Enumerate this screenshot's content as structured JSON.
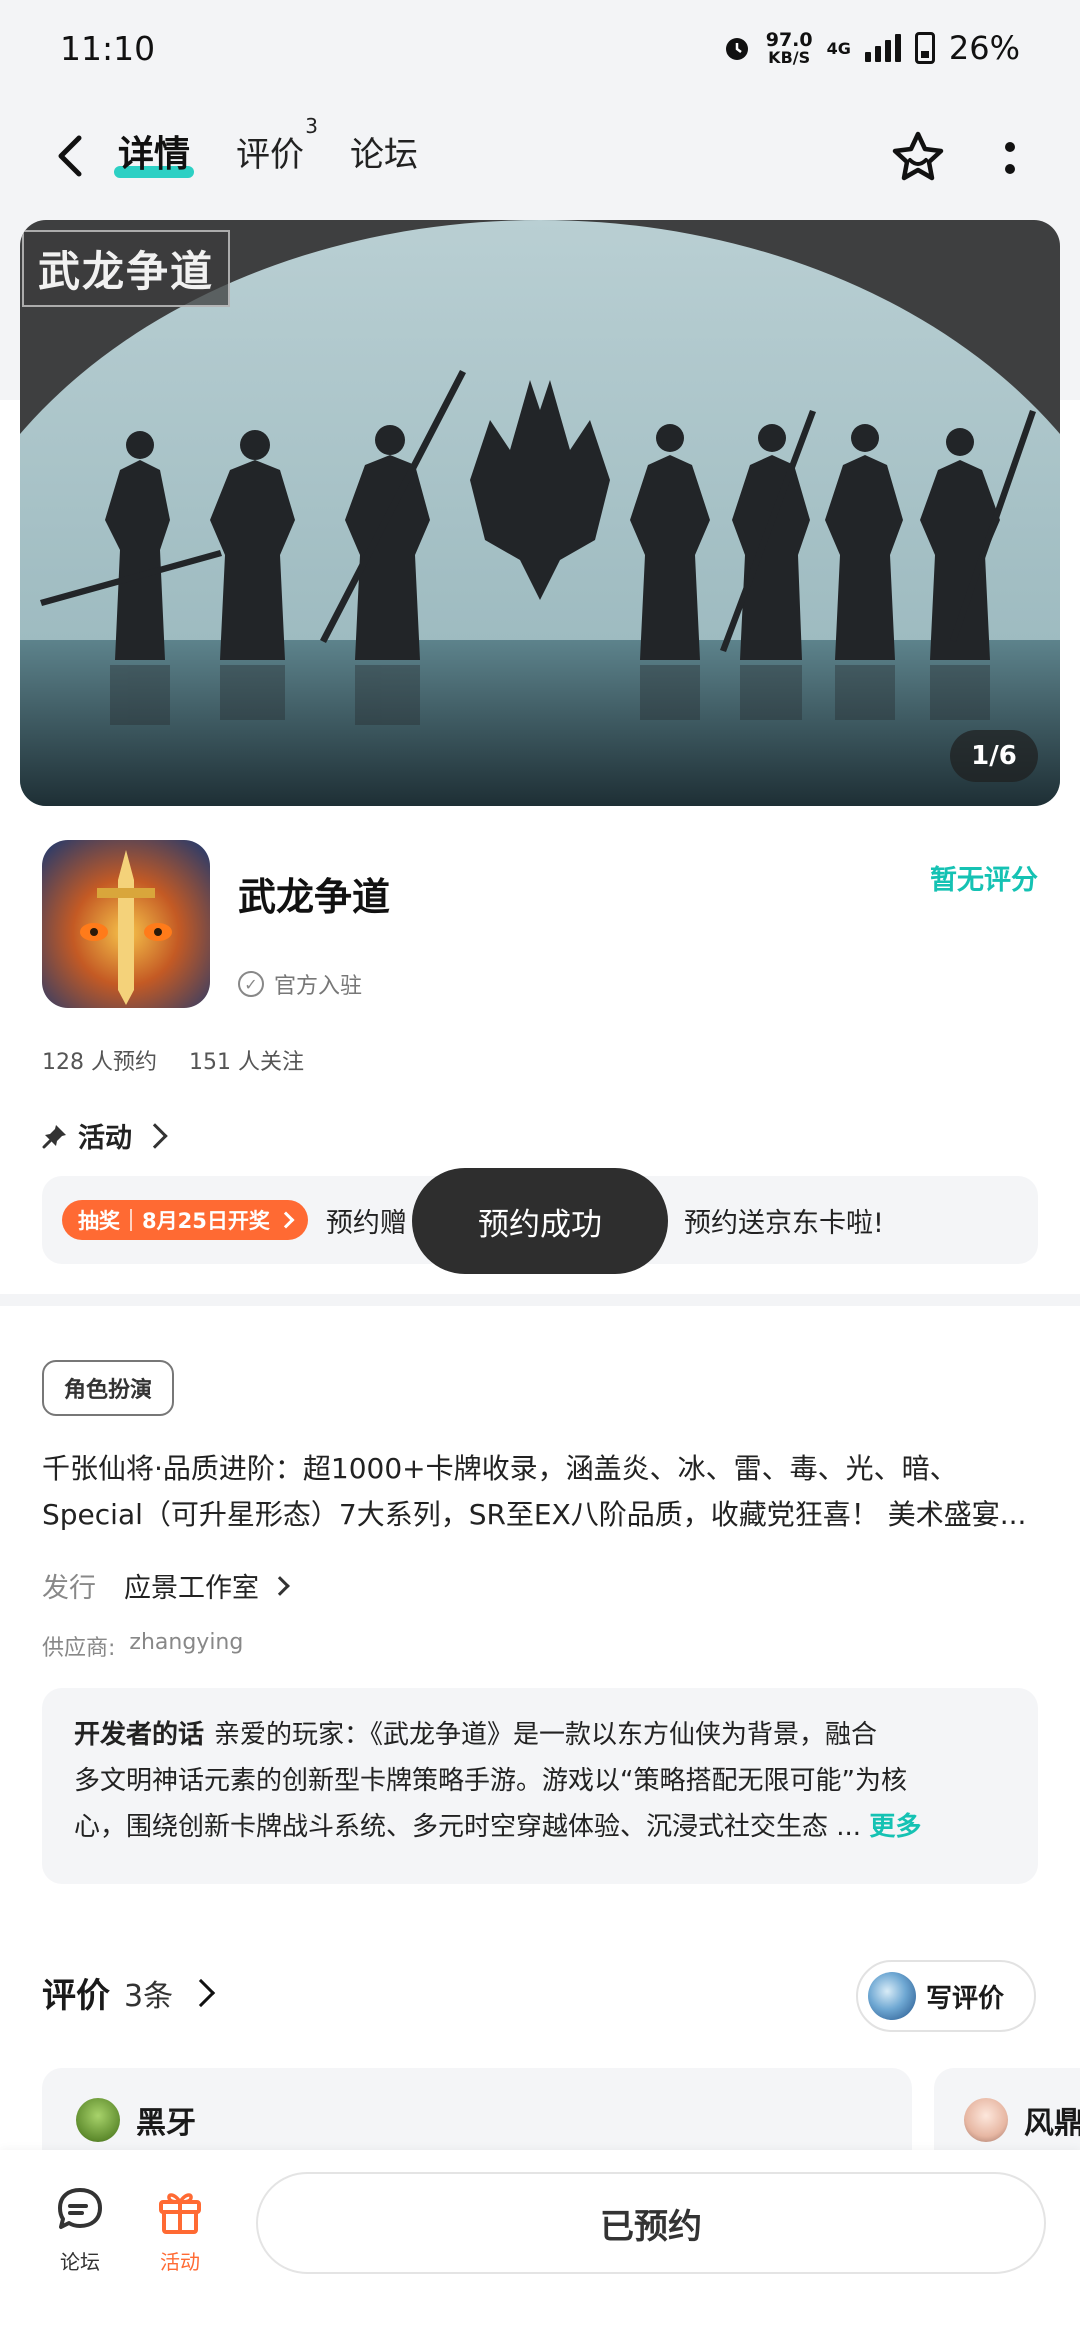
{
  "status_bar": {
    "time": "11:10",
    "net_speed_value": "97.0",
    "net_speed_unit": "KB/S",
    "network": "4G",
    "battery": "26%"
  },
  "nav": {
    "tabs": [
      {
        "label": "详情",
        "active": true
      },
      {
        "label": "评价",
        "badge": "3"
      },
      {
        "label": "论坛"
      }
    ]
  },
  "banner": {
    "logo_text": "武龙争道",
    "counter": "1/6"
  },
  "game": {
    "title": "武龙争道",
    "official_label": "官方入驻",
    "score_text": "暂无评分",
    "score_color": "#15c2b3",
    "reservations": "128 人预约",
    "followers": "151 人关注"
  },
  "activity": {
    "header": "活动",
    "pill_left": "抽奖",
    "pill_right": "8月25日开奖",
    "text_before_toast": "预约赠",
    "text_after_toast": "预约送京东卡啦!",
    "accent_color": "#ff6a33"
  },
  "toast": {
    "text": "预约成功"
  },
  "details": {
    "genre_tag": "角色扮演",
    "description_line1": "千张仙将·品质进阶：超1000+卡牌收录，涵盖炎、冰、雷、毒、光、暗、",
    "description_line2": "Special（可升星形态）7大系列，SR至EX八阶品质，收藏党狂喜！ 美术盛宴...",
    "publisher_label": "发行",
    "publisher_name": "应景工作室",
    "supplier_label": "供应商:",
    "supplier_name": "zhangying"
  },
  "developer_note": {
    "title": "开发者的话",
    "line1": "亲爱的玩家：《武龙争道》是一款以东方仙侠为背景，融合",
    "line2": "多文明神话元素的创新型卡牌策略手游。游戏以“策略搭配无限可能”为核",
    "line3": "心，围绕创新卡牌战斗系统、多元时空穿越体验、沉浸式社交生态 ...",
    "more": "更多"
  },
  "reviews": {
    "title": "评价",
    "count": "3条",
    "write_label": "写评价",
    "items": [
      {
        "name": "黑牙"
      },
      {
        "name": "风鼎"
      }
    ]
  },
  "bottom_bar": {
    "forum_label": "论坛",
    "activity_label": "活动",
    "reserve_button": "已预约"
  }
}
